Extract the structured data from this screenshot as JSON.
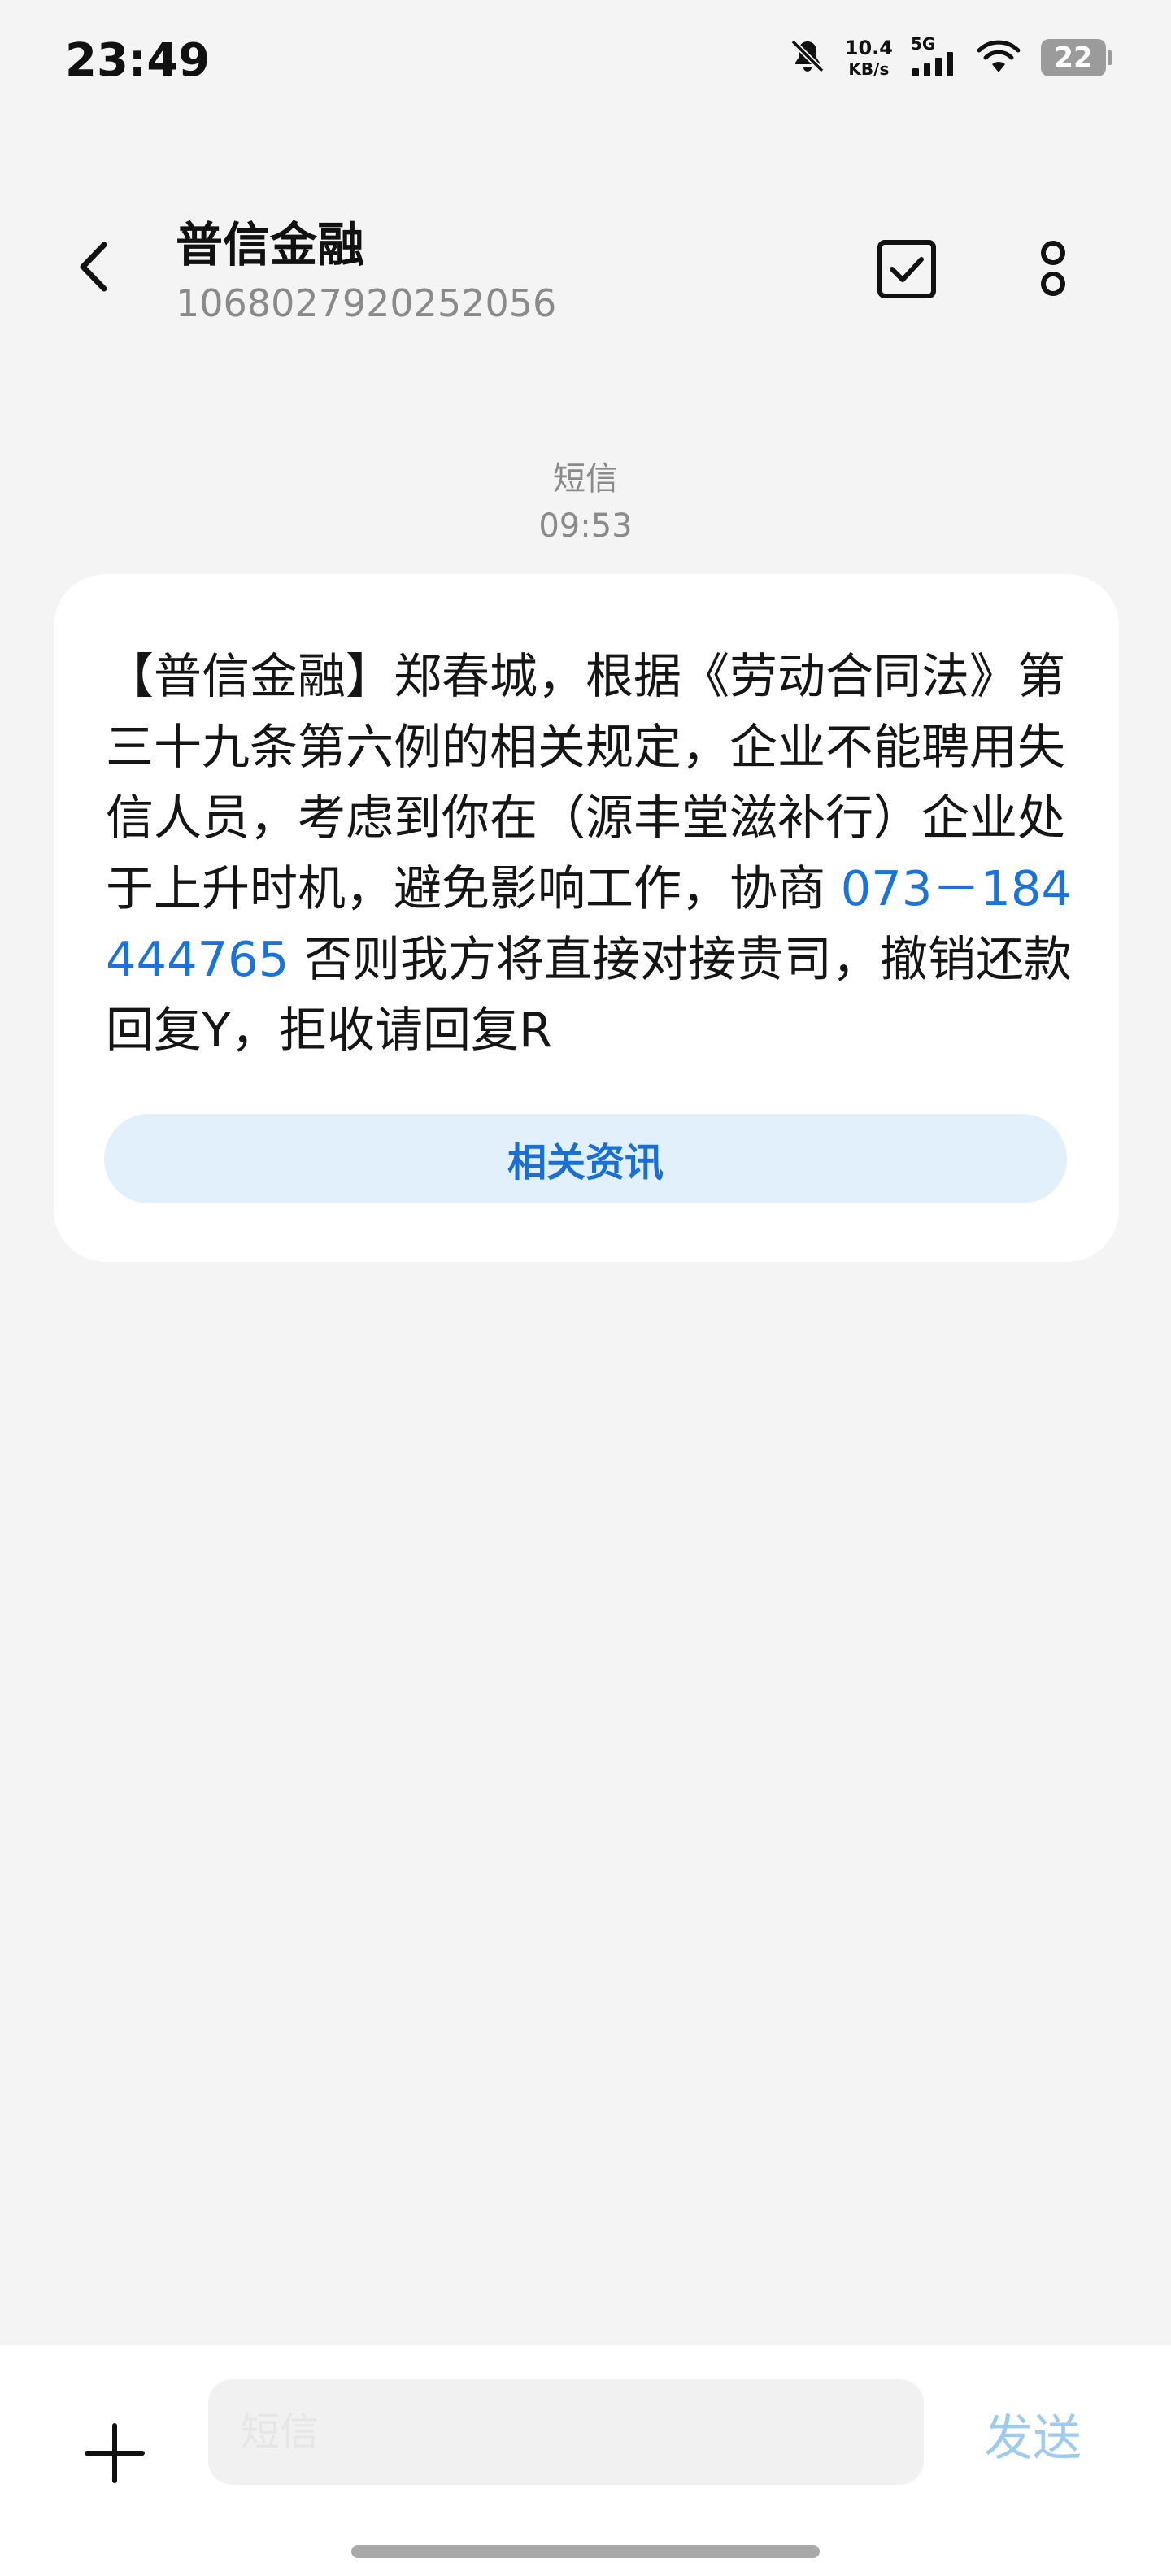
{
  "status_bar": {
    "time": "23:49",
    "net_speed_value": "10.4",
    "net_speed_unit": "KB/s",
    "network_type": "5G",
    "battery_level": "22",
    "icons": [
      "mute-bell-icon",
      "signal-icon",
      "wifi-icon",
      "battery-icon"
    ]
  },
  "header": {
    "contact_name": "普信金融",
    "contact_number": "1068027920252056",
    "icons": [
      "back-arrow-icon",
      "checkbox-select-icon",
      "more-vertical-icon"
    ]
  },
  "message": {
    "channel_label": "短信",
    "timestamp": "09:53",
    "text_before_link": "【普信金融】郑春城，根据《劳动合同法》第三十九条第六例的相关规定，企业不能聘用失信人员，考虑到你在（源丰堂滋补行）企业处于上升时机，避免影响工作，协商 ",
    "phone_link": "073－184444765",
    "text_after_link": " 否则我方将直接对接贵司，撤销还款回复Y，拒收请回复R",
    "related_button_label": "相关资讯"
  },
  "composer": {
    "input_placeholder": "短信",
    "send_label": "发送",
    "icons": [
      "plus-icon"
    ]
  },
  "colors": {
    "background": "#f4f4f4",
    "bubble": "#ffffff",
    "link": "#1a73d9",
    "related_button_bg": "#e2f0fc",
    "send_disabled": "#9fcaf0"
  }
}
